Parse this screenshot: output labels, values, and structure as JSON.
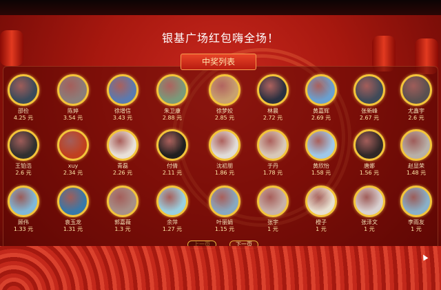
{
  "header": {
    "title": "银基广场红包嗨全场！",
    "banner": "中奖列表"
  },
  "winners": [
    {
      "name": "邵俭",
      "amount": "4.25 元",
      "color": "#3a4a5a"
    },
    {
      "name": "陈婷",
      "amount": "3.54 元",
      "color": "#8b7d7a"
    },
    {
      "name": "徐增信",
      "amount": "3.43 元",
      "color": "#5a7ab0"
    },
    {
      "name": "朱卫康",
      "amount": "2.88 元",
      "color": "#7a9a7a"
    },
    {
      "name": "徐梦姣",
      "amount": "2.85 元",
      "color": "#c8a070"
    },
    {
      "name": "林晨",
      "amount": "2.72 元",
      "color": "#2a3040"
    },
    {
      "name": "黄嘉辉",
      "amount": "2.69 元",
      "color": "#6aa0d0"
    },
    {
      "name": "张新峰",
      "amount": "2.67 元",
      "color": "#404a58"
    },
    {
      "name": "尤鑫宇",
      "amount": "2.6 元",
      "color": "#5a5050"
    },
    {
      "name": "王铂浩",
      "amount": "2.6 元",
      "color": "#303030"
    },
    {
      "name": "xuy",
      "amount": "2.34 元",
      "color": "#c04020"
    },
    {
      "name": "青磊",
      "amount": "2.26 元",
      "color": "#e8e0d8"
    },
    {
      "name": "付倩",
      "amount": "2.11 元",
      "color": "#202020"
    },
    {
      "name": "沈初朋",
      "amount": "1.86 元",
      "color": "#e0dcd8"
    },
    {
      "name": "于丹",
      "amount": "1.78 元",
      "color": "#d8c8b8"
    },
    {
      "name": "黄欣怡",
      "amount": "1.58 元",
      "color": "#a0c8e8"
    },
    {
      "name": "唐娜",
      "amount": "1.56 元",
      "color": "#302828"
    },
    {
      "name": "赵显荣",
      "amount": "1.48 元",
      "color": "#b8b0a8"
    },
    {
      "name": "顾伟",
      "amount": "1.33 元",
      "color": "#80b8d8"
    },
    {
      "name": "袁玉龙",
      "amount": "1.31 元",
      "color": "#3878a8"
    },
    {
      "name": "郭嘉薇",
      "amount": "1.3 元",
      "color": "#a89088"
    },
    {
      "name": "余萍",
      "amount": "1.27 元",
      "color": "#9ad0e0"
    },
    {
      "name": "叶丽娟",
      "amount": "1.15 元",
      "color": "#88a8c0"
    },
    {
      "name": "张宇",
      "amount": "1 元",
      "color": "#c8b0a8"
    },
    {
      "name": "橙子",
      "amount": "1 元",
      "color": "#e8e0d0"
    },
    {
      "name": "张泽文",
      "amount": "1 元",
      "color": "#d8d0d0"
    },
    {
      "name": "李雨友",
      "amount": "1 元",
      "color": "#8ab0c8"
    }
  ],
  "pager": {
    "prev_label": "上一页",
    "next_label": "下一页"
  }
}
